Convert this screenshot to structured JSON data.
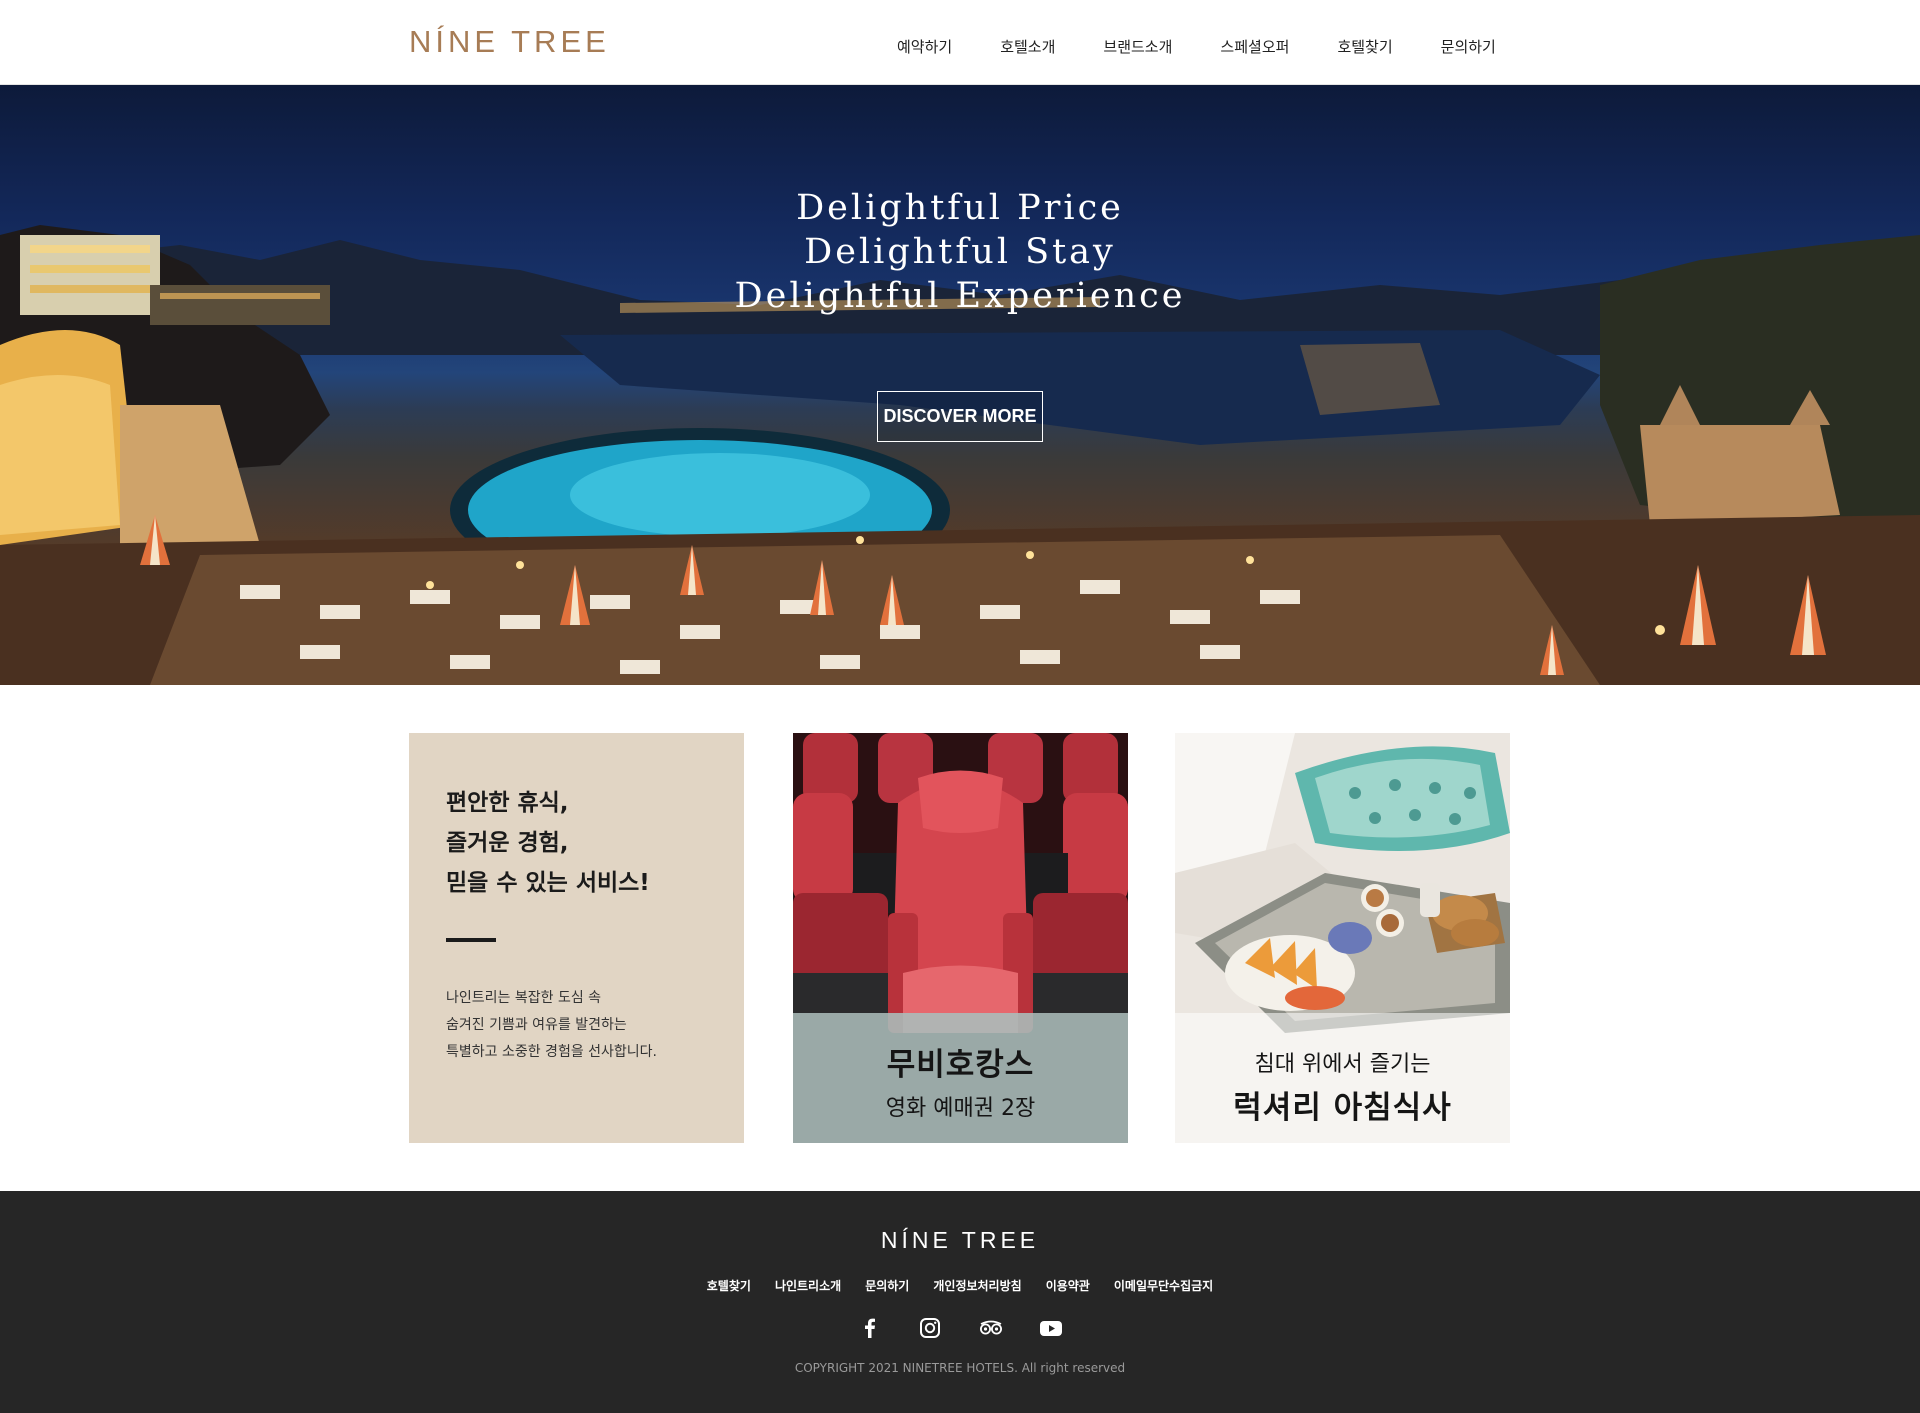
{
  "header": {
    "logo": "NÍNE TREE",
    "nav": [
      "예약하기",
      "호텔소개",
      "브랜드소개",
      "스페셜오퍼",
      "호텔찾기",
      "문의하기"
    ]
  },
  "hero": {
    "lines": [
      "Delightful Price",
      "Delightful Stay",
      "Delightful Experience"
    ],
    "button": "DISCOVER MORE"
  },
  "cards": {
    "intro": {
      "heading": [
        "편안한 휴식,",
        "즐거운 경험,",
        "믿을 수 있는 서비스!"
      ],
      "body": [
        "나인트리는 복잡한 도심 속",
        "숨겨진 기쁨과 여유를 발견하는",
        "특별하고 소중한 경험을 선사합니다."
      ]
    },
    "movie": {
      "title": "무비호캉스",
      "subtitle": "영화 예매권 2장"
    },
    "breakfast": {
      "subtitle": "침대 위에서 즐기는",
      "title": "럭셔리 아침식사"
    }
  },
  "footer": {
    "logo": "NÍNE TREE",
    "links": [
      "호텔찾기",
      "나인트리소개",
      "문의하기",
      "개인정보처리방침",
      "이용약관",
      "이메일무단수집금지"
    ],
    "social_icons": [
      "facebook-icon",
      "instagram-icon",
      "tripadvisor-icon",
      "youtube-icon"
    ],
    "copyright": "COPYRIGHT 2021 NINETREE HOTELS. All right reserved"
  },
  "colors": {
    "brand": "#a77c55",
    "intro_card_bg": "#e1d5c4",
    "footer_bg": "#262626"
  }
}
